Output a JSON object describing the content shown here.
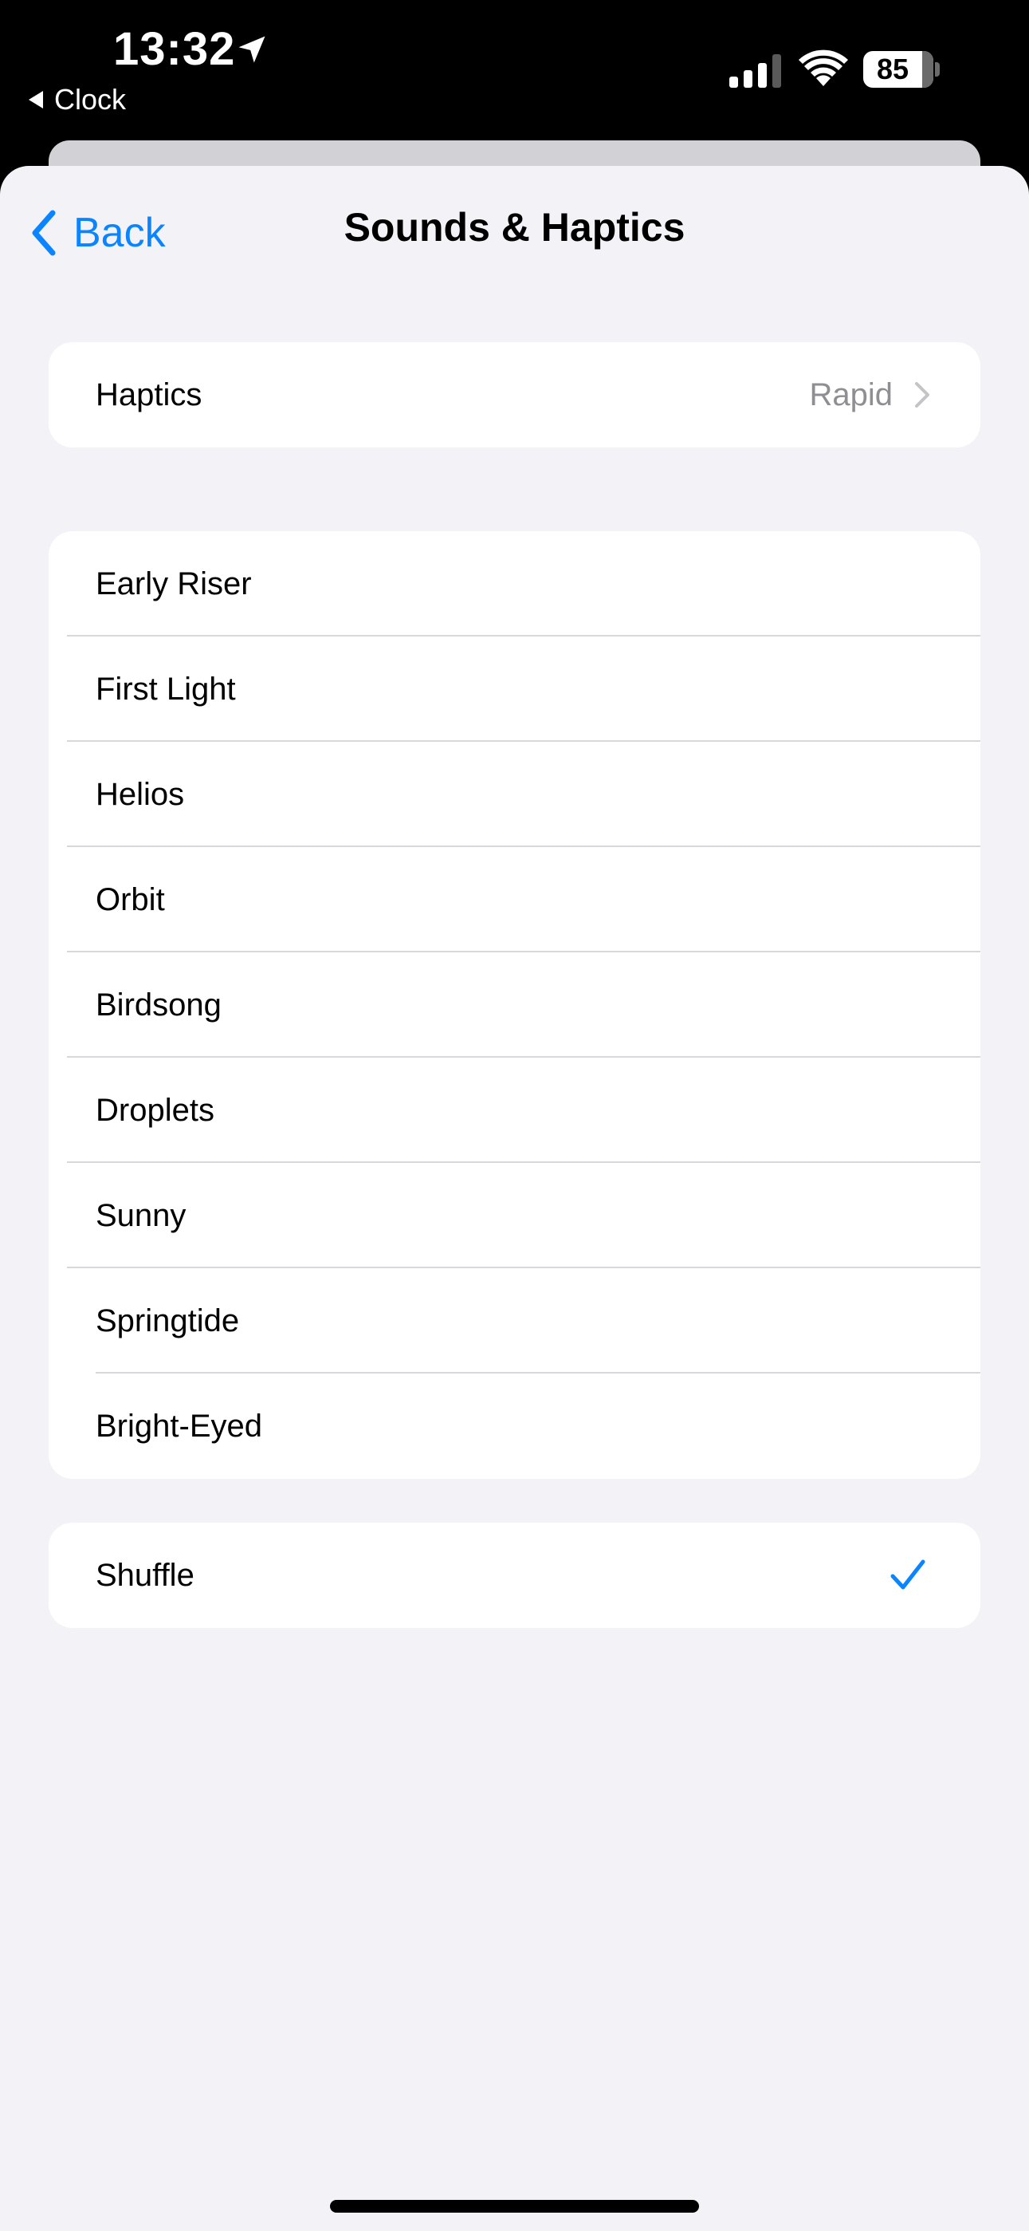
{
  "status_bar": {
    "time": "13:32",
    "back_app": "Clock",
    "battery": "85"
  },
  "nav": {
    "back_label": "Back",
    "title": "Sounds & Haptics"
  },
  "haptics": {
    "label": "Haptics",
    "value": "Rapid"
  },
  "sounds": [
    {
      "label": "Early Riser"
    },
    {
      "label": "First Light"
    },
    {
      "label": "Helios"
    },
    {
      "label": "Orbit"
    },
    {
      "label": "Birdsong"
    },
    {
      "label": "Droplets"
    },
    {
      "label": "Sunny"
    },
    {
      "label": "Springtide"
    },
    {
      "label": "Bright-Eyed"
    }
  ],
  "shuffle": {
    "label": "Shuffle",
    "selected": true
  },
  "colors": {
    "accent": "#0a84ff",
    "background": "#f2f2f7",
    "secondary_text": "#8e8e93"
  }
}
